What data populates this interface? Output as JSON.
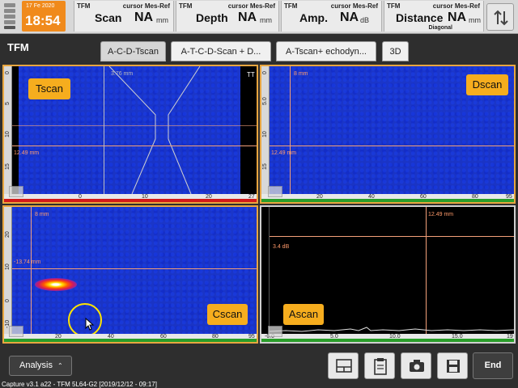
{
  "header": {
    "date": "17 Fe 2020",
    "time": "18:54",
    "readouts": [
      {
        "tag": "TFM",
        "cursor": "cursor Mes-Ref",
        "name": "Scan",
        "value": "NA",
        "unit": "mm",
        "sub": ""
      },
      {
        "tag": "TFM",
        "cursor": "cursor Mes-Ref",
        "name": "Depth",
        "value": "NA",
        "unit": "mm",
        "sub": ""
      },
      {
        "tag": "TFM",
        "cursor": "cursor Mes-Ref",
        "name": "Amp.",
        "value": "NA",
        "unit": "dB",
        "sub": ""
      },
      {
        "tag": "TFM",
        "cursor": "cursor Mes-Ref",
        "name": "Distance",
        "value": "NA",
        "unit": "mm",
        "sub": "Diagonal"
      }
    ]
  },
  "module_title": "TFM",
  "tabs": [
    {
      "label": "A-C-D-Tscan",
      "active": true
    },
    {
      "label": "A-T-C-D-Scan + D...",
      "active": false
    },
    {
      "label": "A-Tscan+ echodyn...",
      "active": false
    },
    {
      "label": "3D",
      "active": false
    }
  ],
  "views": {
    "tscan": {
      "label": "Tscan",
      "corner": "TT",
      "cursor_top": "3.76 mm",
      "cursor_left": "12.49 mm",
      "ruler_left": [
        "0",
        "5",
        "10",
        "15"
      ],
      "ruler_bottom": [
        "0",
        "10",
        "20",
        "27"
      ]
    },
    "dscan": {
      "label": "Dscan",
      "cursor_top": "8 mm",
      "cursor_left": "12.49 mm",
      "ruler_left": [
        "0",
        "5.0",
        "10",
        "15"
      ],
      "ruler_bottom": [
        "20",
        "40",
        "60",
        "80",
        "95"
      ]
    },
    "cscan": {
      "label": "Cscan",
      "cursor_top": "8 mm",
      "cursor_left": "-13.74 mm",
      "ruler_left": [
        "20",
        "10",
        "0",
        "-10"
      ],
      "ruler_bottom": [
        "20",
        "40",
        "60",
        "80",
        "95"
      ]
    },
    "ascan": {
      "label": "Ascan",
      "cursor_top": "12.49 mm",
      "gain": "3.4 dB",
      "ruler_left": [
        "0",
        "5.0",
        "10.0",
        "15.0"
      ],
      "ruler_bottom": [
        "-0.0",
        "5.0",
        "10.0",
        "15.0",
        "19"
      ]
    }
  },
  "toolbar": {
    "analysis_label": "Analysis",
    "end_label": "End",
    "icons": [
      "layout-icon",
      "clipboard-icon",
      "camera-icon",
      "save-icon"
    ]
  },
  "footer": "Capture v3.1 a22 - TFM 5L64-G2 [2019/12/12 - 09:17]",
  "colors": {
    "accent": "#f6ad1e",
    "clock": "#f08a1c",
    "cursor": "#f3a07a",
    "scan_bg": "#1b36c9"
  }
}
